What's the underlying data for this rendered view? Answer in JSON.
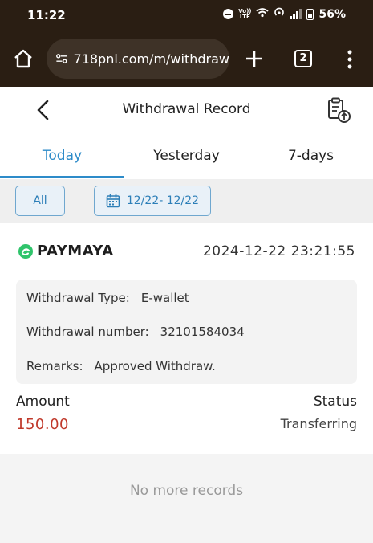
{
  "status_bar": {
    "time": "11:22",
    "volte_top": "Vo))",
    "volte_bottom": "LTE",
    "battery": "56%"
  },
  "browser": {
    "url": "718pnl.com/m/withdraw",
    "tab_count": "2"
  },
  "header": {
    "title": "Withdrawal Record"
  },
  "tabs": [
    {
      "label": "Today",
      "active": true
    },
    {
      "label": "Yesterday",
      "active": false
    },
    {
      "label": "7-days",
      "active": false
    }
  ],
  "filters": {
    "all_label": "All",
    "date_range": "12/22- 12/22"
  },
  "record": {
    "provider": "PAYMAYA",
    "datetime": "2024-12-22 23:21:55",
    "withdrawal_type_label": "Withdrawal Type:",
    "withdrawal_type_value": "E-wallet",
    "withdrawal_number_label": "Withdrawal number:",
    "withdrawal_number_value": "32101584034",
    "remarks_label": "Remarks:",
    "remarks_value": "Approved Withdraw.",
    "amount_label": "Amount",
    "amount_value": "150.00",
    "status_label": "Status",
    "status_value": "Transferring"
  },
  "footer": {
    "no_more": "No more records"
  },
  "colors": {
    "accent": "#2d8bc9",
    "amount": "#c0392b",
    "chrome": "#2a1e13",
    "logo_green": "#2fc46b"
  },
  "icons": [
    "home-icon",
    "site-settings-icon",
    "plus-icon",
    "tabs-icon",
    "more-vert-icon",
    "back-arrow-icon",
    "export-icon",
    "calendar-icon",
    "paymaya-logo-icon"
  ]
}
